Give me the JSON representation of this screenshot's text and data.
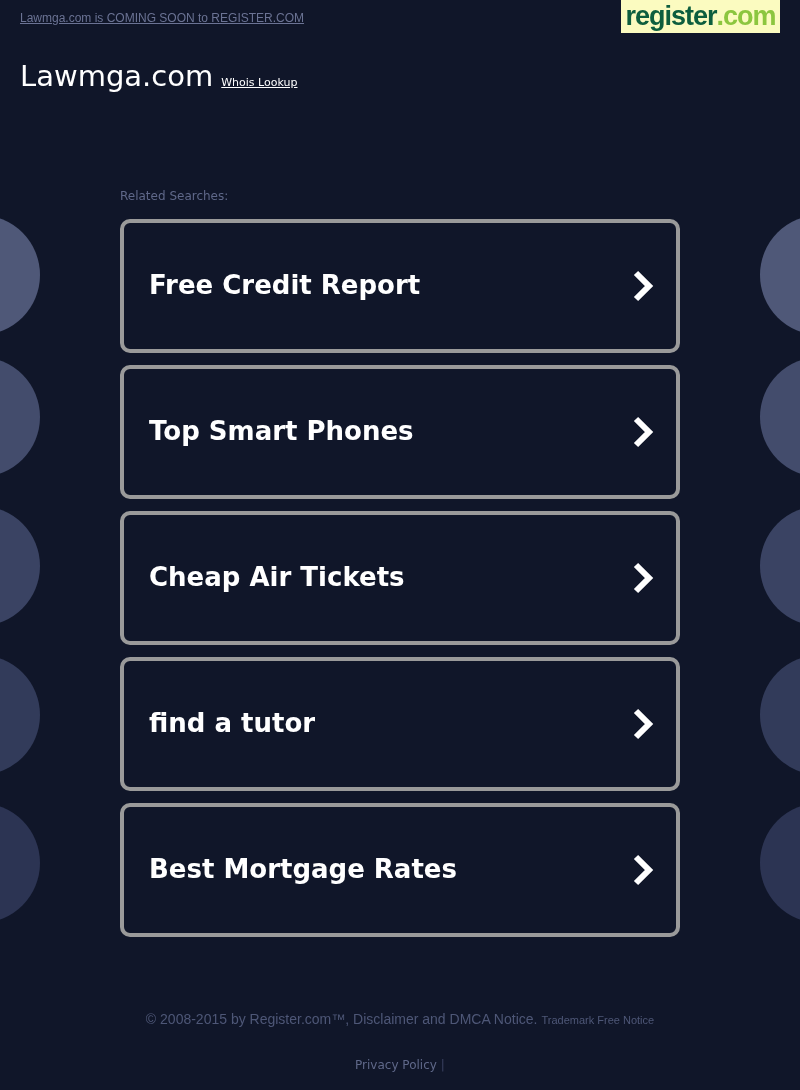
{
  "top_banner": {
    "link": "Lawmga.com is COMING SOON to REGISTER.COM",
    "logo": {
      "name": "register",
      "suffix": ".com"
    }
  },
  "header": {
    "title": "Lawmga.com",
    "link": "Whois Lookup"
  },
  "related": {
    "heading": "Related Searches:",
    "items": [
      {
        "label": "Free Credit Report"
      },
      {
        "label": "Top Smart Phones"
      },
      {
        "label": "Cheap Air Tickets"
      },
      {
        "label": "find a tutor"
      },
      {
        "label": "Best Mortgage Rates"
      }
    ]
  },
  "footer": {
    "copyright": "© 2008-2015 by Register.com™, Disclaimer and DMCA Notice.",
    "trademark": "Trademark Free Notice",
    "privacy": "Privacy Policy",
    "separator": "|"
  }
}
